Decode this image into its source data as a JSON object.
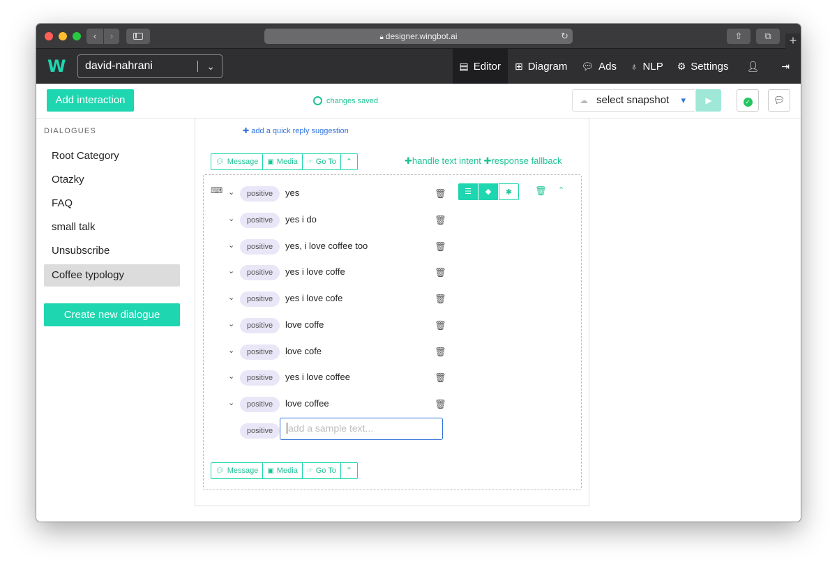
{
  "browser": {
    "url": "designer.wingbot.ai"
  },
  "header": {
    "logo_text": "W",
    "project": "david-nahrani",
    "nav": [
      {
        "label": "Editor",
        "icon": "editor-icon",
        "active": true
      },
      {
        "label": "Diagram",
        "icon": "sitemap-icon",
        "active": false
      },
      {
        "label": "Ads",
        "icon": "chat-icon",
        "active": false
      },
      {
        "label": "NLP",
        "icon": "lightbulb-icon",
        "active": false
      },
      {
        "label": "Settings",
        "icon": "gears-icon",
        "active": false
      }
    ]
  },
  "toolbar": {
    "add_interaction": "Add interaction",
    "status": "changes saved",
    "snapshot_placeholder": "select snapshot"
  },
  "sidebar": {
    "title": "DIALOGUES",
    "items": [
      {
        "label": "Root Category",
        "active": false
      },
      {
        "label": "Otazky",
        "active": false
      },
      {
        "label": "FAQ",
        "active": false
      },
      {
        "label": "small talk",
        "active": false
      },
      {
        "label": "Unsubscribe",
        "active": false
      },
      {
        "label": "Coffee typology",
        "active": true
      }
    ],
    "create_button": "Create new dialogue"
  },
  "editor": {
    "quick_reply_link": "add a quick reply suggestion",
    "actions": [
      "Message",
      "Media",
      "Go To"
    ],
    "handle_text_intent": "handle text intent",
    "response_fallback": "response fallback",
    "intent_tag": "positive",
    "samples": [
      "yes",
      "yes i do",
      "yes, i love coffee too",
      "yes i love coffe",
      "yes i love cofe",
      "love coffe",
      "love cofe",
      "yes i love coffee",
      "love coffee"
    ],
    "new_sample_placeholder": "add a sample text..."
  },
  "colors": {
    "accent": "#1ed6b0",
    "link": "#3273dc",
    "pill_bg": "#e9e6f7",
    "header_bg": "#2f2f31"
  }
}
